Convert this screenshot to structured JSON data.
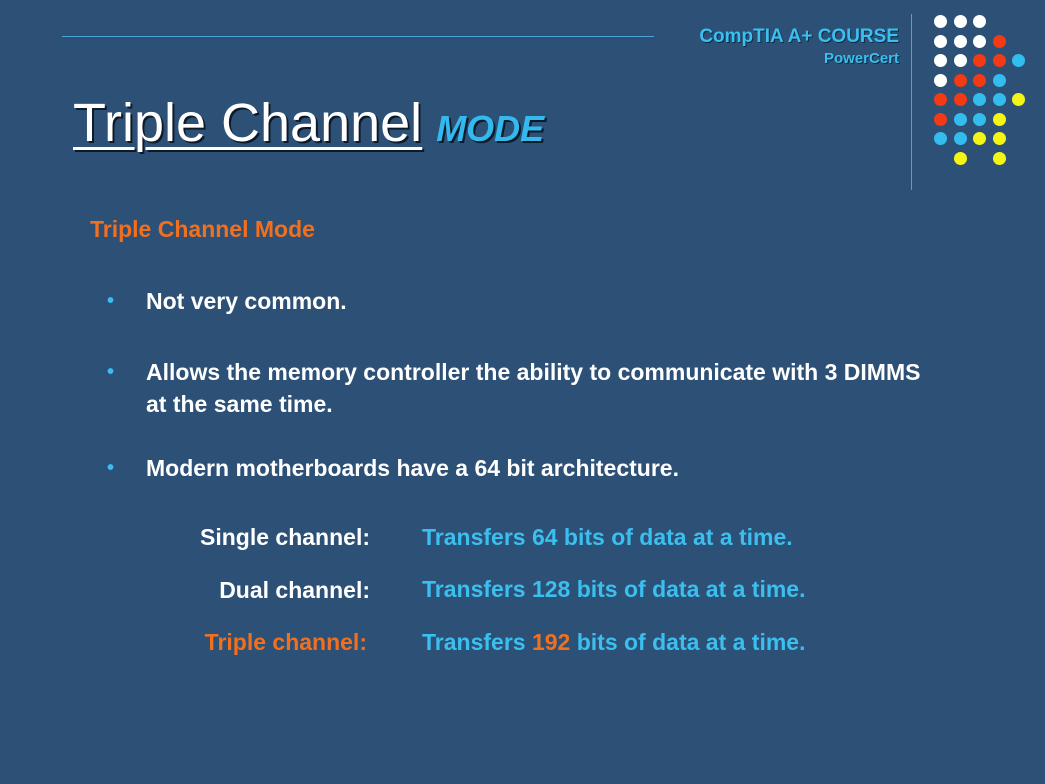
{
  "header": {
    "course": "CompTIA A+ COURSE",
    "brand": "PowerCert"
  },
  "title": {
    "main": "Triple Channel",
    "accent": "MODE"
  },
  "subheading": "Triple Channel Mode",
  "bullets": [
    {
      "text": "Not very common."
    },
    {
      "text": "Allows the memory controller the ability to communicate with 3 DIMMS at the same time."
    },
    {
      "text": "Modern motherboards have a 64 bit architecture."
    }
  ],
  "channels": [
    {
      "label": "Single channel:",
      "value_pre": "Transfers 64 bits of data at a time.",
      "value_num": "",
      "value_post": ""
    },
    {
      "label": "Dual channel:",
      "value_pre": "Transfers 128 bits of data at a time.",
      "value_num": "",
      "value_post": ""
    },
    {
      "label": "Triple channel:",
      "value_pre": "Transfers ",
      "value_num": "192",
      "value_post": " bits of data at a time."
    }
  ],
  "colors": {
    "background": "#2c5076",
    "accent_blue": "#3bbfef",
    "accent_orange": "#f07020",
    "dot_white": "#ffffff",
    "dot_red": "#f23a14",
    "dot_cyan": "#33bdef",
    "dot_yellow": "#f5f515"
  },
  "decoration": {
    "dot_grid": [
      [
        "white",
        "white",
        "white",
        "",
        ""
      ],
      [
        "white",
        "white",
        "white",
        "red",
        ""
      ],
      [
        "white",
        "white",
        "red",
        "red",
        "cyan"
      ],
      [
        "white",
        "red",
        "red",
        "cyan",
        ""
      ],
      [
        "red",
        "red",
        "cyan",
        "cyan",
        "yellow"
      ],
      [
        "red",
        "cyan",
        "cyan",
        "yellow",
        ""
      ],
      [
        "cyan",
        "cyan",
        "yellow",
        "yellow",
        ""
      ],
      [
        "",
        "yellow",
        "",
        "yellow",
        ""
      ]
    ]
  }
}
